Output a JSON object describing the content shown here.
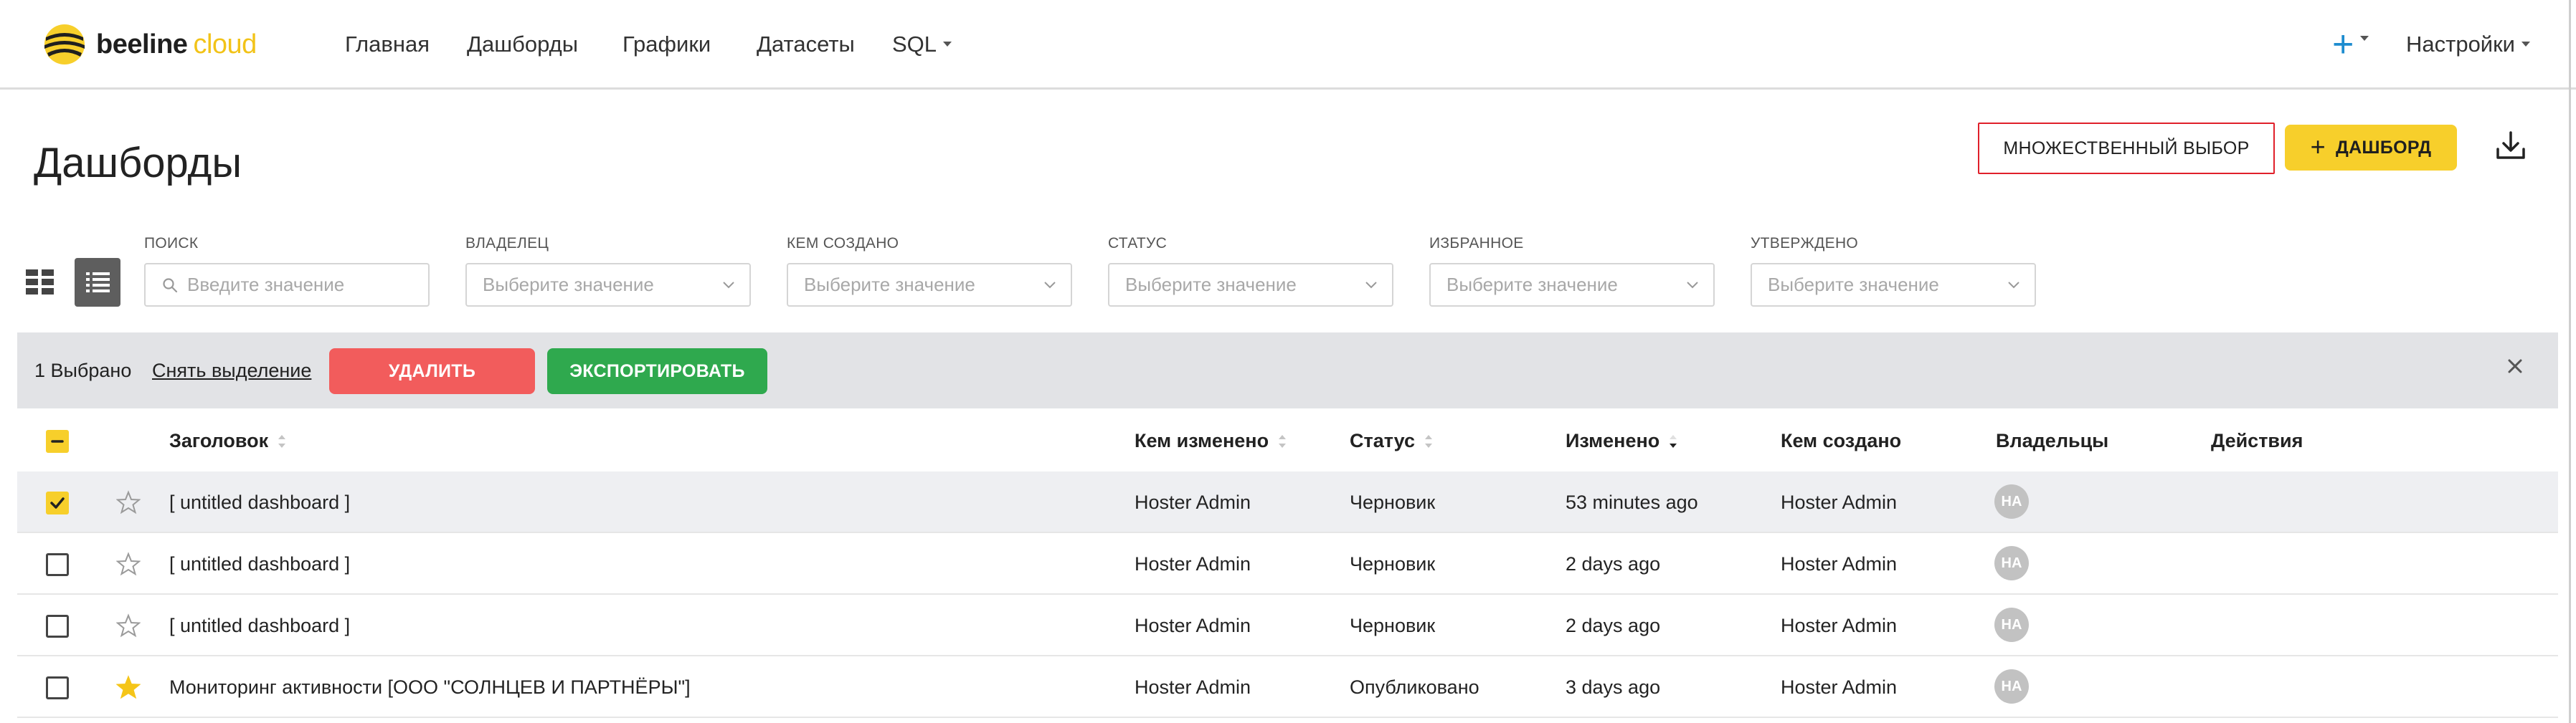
{
  "brand": {
    "name_part1": "beeline",
    "name_part2": "cloud",
    "accent": "#f7cf2b"
  },
  "nav": {
    "items": [
      "Главная",
      "Дашборды",
      "Графики",
      "Датасеты",
      "SQL"
    ],
    "settings_label": "Настройки",
    "plus_label": "+"
  },
  "page": {
    "title": "Дашборды",
    "multi_select_label": "МНОЖЕСТВЕННЫЙ ВЫБОР",
    "add_dashboard_label": "ДАШБОРД"
  },
  "filters": {
    "search": {
      "label": "ПОИСК",
      "placeholder": "Введите значение"
    },
    "owner": {
      "label": "ВЛАДЕЛЕЦ",
      "placeholder": "Выберите значение"
    },
    "created_by": {
      "label": "КЕМ СОЗДАНО",
      "placeholder": "Выберите значение"
    },
    "status": {
      "label": "СТАТУС",
      "placeholder": "Выберите значение"
    },
    "favorite": {
      "label": "ИЗБРАННОЕ",
      "placeholder": "Выберите значение"
    },
    "approved": {
      "label": "УТВЕРЖДЕНО",
      "placeholder": "Выберите значение"
    }
  },
  "bulk": {
    "selected_count_text": "1 Выбрано",
    "clear_selection_label": "Снять выделение",
    "delete_label": "УДАЛИТЬ",
    "export_label": "ЭКСПОРТИРОВАТЬ",
    "delete_color": "#f25c5c",
    "export_color": "#2fa94e"
  },
  "table": {
    "columns": {
      "title": "Заголовок",
      "changed_by": "Кем изменено",
      "status": "Статус",
      "modified": "Изменено",
      "created_by": "Кем создано",
      "owners": "Владельцы",
      "actions": "Действия"
    },
    "rows": [
      {
        "selected": true,
        "favorite": false,
        "title": "[ untitled dashboard ]",
        "changed_by": "Hoster Admin",
        "status": "Черновик",
        "modified": "53 minutes ago",
        "created_by": "Hoster Admin",
        "owner_initials": "HA"
      },
      {
        "selected": false,
        "favorite": false,
        "title": "[ untitled dashboard ]",
        "changed_by": "Hoster Admin",
        "status": "Черновик",
        "modified": "2 days ago",
        "created_by": "Hoster Admin",
        "owner_initials": "HA"
      },
      {
        "selected": false,
        "favorite": false,
        "title": "[ untitled dashboard ]",
        "changed_by": "Hoster Admin",
        "status": "Черновик",
        "modified": "2 days ago",
        "created_by": "Hoster Admin",
        "owner_initials": "HA"
      },
      {
        "selected": false,
        "favorite": true,
        "title": "Мониторинг активности [ООО \"СОЛНЦЕВ И ПАРТНЁРЫ\"]",
        "changed_by": "Hoster Admin",
        "status": "Опубликовано",
        "modified": "3 days ago",
        "created_by": "Hoster Admin",
        "owner_initials": "HA"
      }
    ]
  }
}
